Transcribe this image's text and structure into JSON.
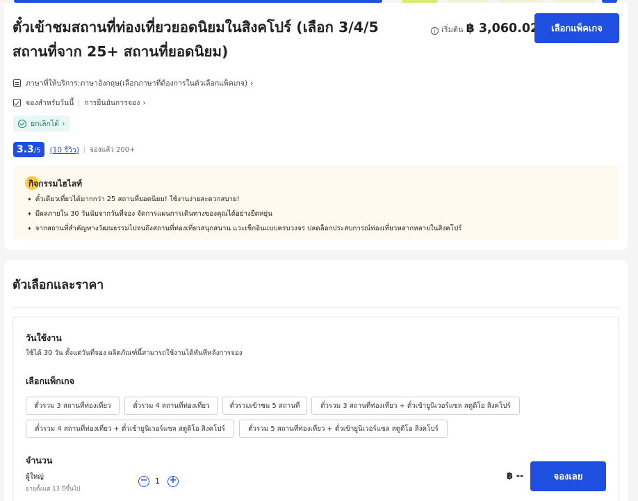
{
  "colors": {
    "primary": "#1f4fe0",
    "success": "#0d8b63",
    "highlight_bg": "#fffaef",
    "accent_yellow": "#ffc94a"
  },
  "header": {
    "title": "ตั๋วเข้าชมสถานที่ท่องเที่ยวยอดนิยมในสิงคโปร์ (เลือก 3/4/5 สถานที่จาก 25+ สถานที่ยอดนิยม)",
    "price_from_label": "เริ่มต้น",
    "price_value": "฿ 3,060.02",
    "select_button": "เลือกแพ็คเกจ",
    "info_icon": "info-icon"
  },
  "meta": {
    "language": "ภาษาที่ให้บริการ:ภาษาอังกฤษ(เลือกภาษาที่ต้องการในตัวเลือกแพ็คเกจ)",
    "book_today": "จองสำหรับวันนี้",
    "confirmation": "การยืนยันการจอง",
    "cancel": "ยกเลิกได้"
  },
  "rating": {
    "score": "3.3",
    "max": "/5",
    "reviews": "(10 รีวิว)",
    "booked": "จองแล้ว 200+"
  },
  "highlights": {
    "title": "กิจกรรมไฮไลท์",
    "items": [
      "ตั๋วเดียวเที่ยวได้มากกว่า 25 สถานที่ยอดนิยม! ใช้งานง่ายสะดวกสบาย!",
      "มีผลภายใน 30 วันนับจากวันที่จอง จัดการแผนการเดินทางของคุณได้อย่างยืดหยุ่น",
      "จากสถานที่สำคัญทางวัฒนธรรมไปจนถึงสถานที่ท่องเที่ยวสนุกสนาน แวะเช็กอินแบบครบวงจร ปลดล็อกประสบการณ์ท่องเที่ยวหลากหลายในสิงคโปร์"
    ]
  },
  "options": {
    "section_title": "ตัวเลือกและราคา",
    "usage_title": "วันใช้งาน",
    "usage_note": "ใช้ได้ 30 วัน ตั้งแต่วันที่จอง ผลิตภัณฑ์นี้สามารถใช้งานได้ทันทีหลังการจอง",
    "package_title": "เลือกแพ็กเกจ",
    "packages": [
      "ตั๋วรวม 3 สถานที่ท่องเที่ยว",
      "ตั๋วรวม 4 สถานที่ท่องเที่ยว",
      "ตั๋วรวมเข้าชม 5 สถานที่",
      "ตั๋วรวม 3 สถานที่ท่องเที่ยว + ตั๋วเข้ายูนิเวอร์แซล สตูดิโอ สิงคโปร์",
      "ตั๋วรวม 4 สถานที่ท่องเที่ยว + ตั๋วเข้ายูนิเวอร์แซล สตูดิโอ สิงคโปร์",
      "ตั๋วรวม 5 สถานที่ท่องเที่ยว + ตั๋วเข้ายูนิเวอร์แซล สตูดิโอ สิงคโปร์"
    ],
    "quantity_title": "จำนวน",
    "adult_label": "ผู้ใหญ่",
    "adult_sub": "อายุตั้งแต่ 13 ปีขึ้นไป",
    "quantity": "1",
    "minus": "−",
    "plus": "+",
    "total": "฿ --",
    "book_button": "จองเลย"
  }
}
